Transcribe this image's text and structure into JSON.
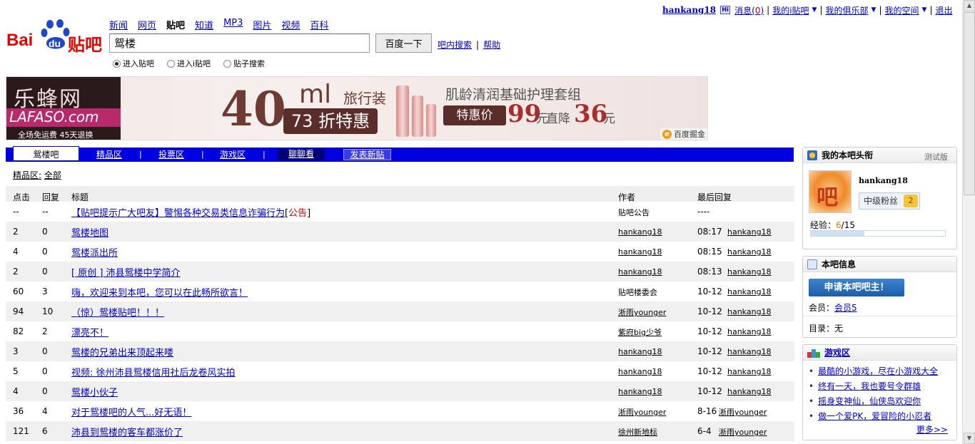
{
  "userbar": {
    "username": "hankang18",
    "hi_icon": "Hi-icon",
    "messages_label": "消息(",
    "messages_count": "0",
    "messages_close": ")",
    "my_ibar": "我的i贴吧",
    "my_club": "我的俱乐部",
    "my_space": "我的空间",
    "logout": "退出"
  },
  "logo": {
    "brand": "Bai",
    "du": "du",
    "tieba": "贴吧"
  },
  "navlinks": [
    "新闻",
    "网页",
    "贴吧",
    "知道",
    "MP3",
    "图片",
    "视频",
    "百科"
  ],
  "nav_current": "贴吧",
  "search": {
    "value": "鸳楼",
    "button": "百度一下",
    "in_bar": "吧内搜索",
    "help": "帮助",
    "options": [
      {
        "label": "进入贴吧",
        "checked": true
      },
      {
        "label": "进入i贴吧",
        "checked": false
      },
      {
        "label": "贴子搜索",
        "checked": false
      }
    ]
  },
  "banner": {
    "brand_cn": "乐蜂网",
    "brand_en": "LAFASO.com",
    "promo": "全场免运费   45天退换",
    "size": "40",
    "unit": "ml",
    "travel": "旅行装",
    "discount": "73 折特惠",
    "product": "肌龄清润基础护理套组",
    "special": "特惠价",
    "price": "99",
    "yuan": "元",
    "cut": "直降",
    "cut_amount": "36",
    "yuan2": "元",
    "ad_tag": "百度掘金"
  },
  "tabs": {
    "current": "鸳楼吧",
    "items": [
      "精品区",
      "投票区",
      "游戏区"
    ],
    "chat": "聊聊看",
    "post": "发表新贴"
  },
  "breadcrumb": {
    "label": "精品区:",
    "all": "全部"
  },
  "threads": {
    "headers": [
      "点击",
      "回复",
      "标题",
      "作者",
      "最后回复"
    ],
    "rows": [
      {
        "clicks": "--",
        "replies": "--",
        "title": "【贴吧提示广大吧友】警惕各种交易类信息诈骗行为",
        "tag": "公告",
        "author": "贴吧公告",
        "author_link": false,
        "last_time": "----",
        "last_user": ""
      },
      {
        "clicks": "2",
        "replies": "0",
        "title": "鸳楼地图",
        "author": "hankang18",
        "author_link": true,
        "last_time": "08:17",
        "last_user": "hankang18"
      },
      {
        "clicks": "4",
        "replies": "0",
        "title": "鸳楼派出所",
        "author": "hankang18",
        "author_link": true,
        "last_time": "08:15",
        "last_user": "hankang18"
      },
      {
        "clicks": "2",
        "replies": "0",
        "title": "[ 原创 ] 沛县鸳楼中学简介",
        "author": "hankang18",
        "author_link": true,
        "last_time": "08:13",
        "last_user": "hankang18"
      },
      {
        "clicks": "60",
        "replies": "3",
        "title": "嗨，欢迎来到本吧，您可以在此畅所欲言！",
        "author": "贴吧楼委会",
        "author_link": false,
        "last_time": "10-12",
        "last_user": "hankang18"
      },
      {
        "clicks": "94",
        "replies": "10",
        "title": "（惊）鸳楼贴吧！！！",
        "author": "淅雨younger",
        "author_link": true,
        "last_time": "10-12",
        "last_user": "hankang18"
      },
      {
        "clicks": "82",
        "replies": "2",
        "title": "漂亮不！",
        "author": "紫府big少爷",
        "author_link": true,
        "last_time": "10-12",
        "last_user": "hankang18"
      },
      {
        "clicks": "3",
        "replies": "0",
        "title": "鸳楼的兄弟出来顶起来喽",
        "author": "hankang18",
        "author_link": true,
        "last_time": "10-12",
        "last_user": "hankang18"
      },
      {
        "clicks": "5",
        "replies": "0",
        "title": "视频: 徐州沛县鸳楼信用社后龙卷风实拍",
        "author": "hankang18",
        "author_link": true,
        "last_time": "10-12",
        "last_user": "hankang18"
      },
      {
        "clicks": "4",
        "replies": "0",
        "title": "鸳楼小伙子",
        "author": "hankang18",
        "author_link": true,
        "last_time": "10-12",
        "last_user": "hankang18"
      },
      {
        "clicks": "36",
        "replies": "4",
        "title": "对于鸳楼吧的人气...好无语！",
        "author": "淅雨younger",
        "author_link": true,
        "last_time": "8-16",
        "last_user": "淅雨younger"
      },
      {
        "clicks": "121",
        "replies": "6",
        "title": "沛县到鸳楼的客车都涨价了",
        "author": "徐州新地标",
        "author_link": true,
        "last_time": "6-4",
        "last_user": "淅雨younger"
      }
    ]
  },
  "panel_rank": {
    "title": "我的本吧头衔",
    "version": "测试版",
    "username": "hankang18",
    "level": "中级粉丝",
    "level_num": "2",
    "exp_label": "经验：",
    "exp_value": "6",
    "exp_total": "/15",
    "exp_progress": 0.4
  },
  "panel_info": {
    "title": "本吧信息",
    "apply": "申请本吧吧主！",
    "members_label": "会员：",
    "members_link": "会员5",
    "catalog": "目录：无"
  },
  "panel_games": {
    "title": "游戏区",
    "items": [
      "最酷的小游戏，尽在小游戏大全",
      "终有一天，我也要号令群雄",
      "摇身变神仙，仙侠岛欢迎你",
      "做一个爱PK，爱冒险的小忍者"
    ],
    "more": "更多>>"
  },
  "colors": {
    "tabbar": "#0000e1",
    "link": "#0000cc",
    "notice": "#cc0000"
  }
}
